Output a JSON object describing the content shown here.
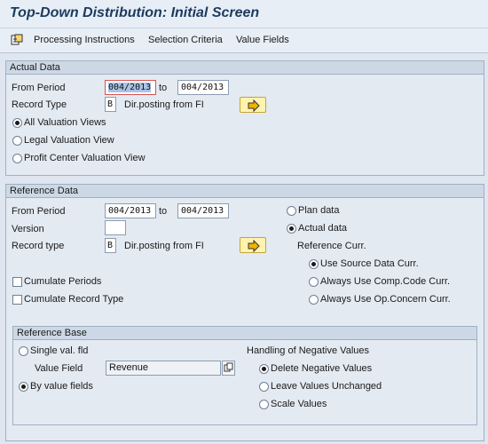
{
  "title": "Top-Down Distribution: Initial Screen",
  "toolbar": {
    "processing_instructions": "Processing Instructions",
    "selection_criteria": "Selection Criteria",
    "value_fields": "Value Fields"
  },
  "actual": {
    "frame_title": "Actual Data",
    "from_period_label": "From Period",
    "from_period": "004/2013",
    "to_label": "to",
    "to_period": "004/2013",
    "record_type_label": "Record Type",
    "record_type": "B",
    "record_type_desc": "Dir.posting from FI",
    "views": [
      "All Valuation Views",
      "Legal Valuation View",
      "Profit Center Valuation View"
    ],
    "selected_view": 0
  },
  "reference": {
    "frame_title": "Reference Data",
    "from_period_label": "From Period",
    "from_period": "004/2013",
    "to_label": "to",
    "to_period": "004/2013",
    "version_label": "Version",
    "version": "",
    "record_type_label": "Record type",
    "record_type": "B",
    "record_type_desc": "Dir.posting from FI",
    "plan_data": "Plan data",
    "actual_data": "Actual data",
    "actual_selected": true,
    "ref_curr_label": "Reference Curr.",
    "currencies": [
      "Use Source Data Curr.",
      "Always Use Comp.Code Curr.",
      "Always Use Op.Concern Curr."
    ],
    "selected_currency": 0,
    "cumulate_periods": "Cumulate Periods",
    "cumulate_record_type": "Cumulate Record Type"
  },
  "base": {
    "frame_title": "Reference Base",
    "single_val": "Single val. fld",
    "value_field_label": "Value Field",
    "value_field": "Revenue",
    "by_value_fields": "By value fields",
    "neg_label": "Handling of Negative Values",
    "neg_options": [
      "Delete Negative Values",
      "Leave Values Unchanged",
      "Scale Values"
    ],
    "selected_neg": 0
  },
  "colors": {
    "background": "#dfe6ef",
    "frame_header": "#cdd8e6",
    "title": "#1b3b5f",
    "arrow_button": "#fff3b0"
  }
}
